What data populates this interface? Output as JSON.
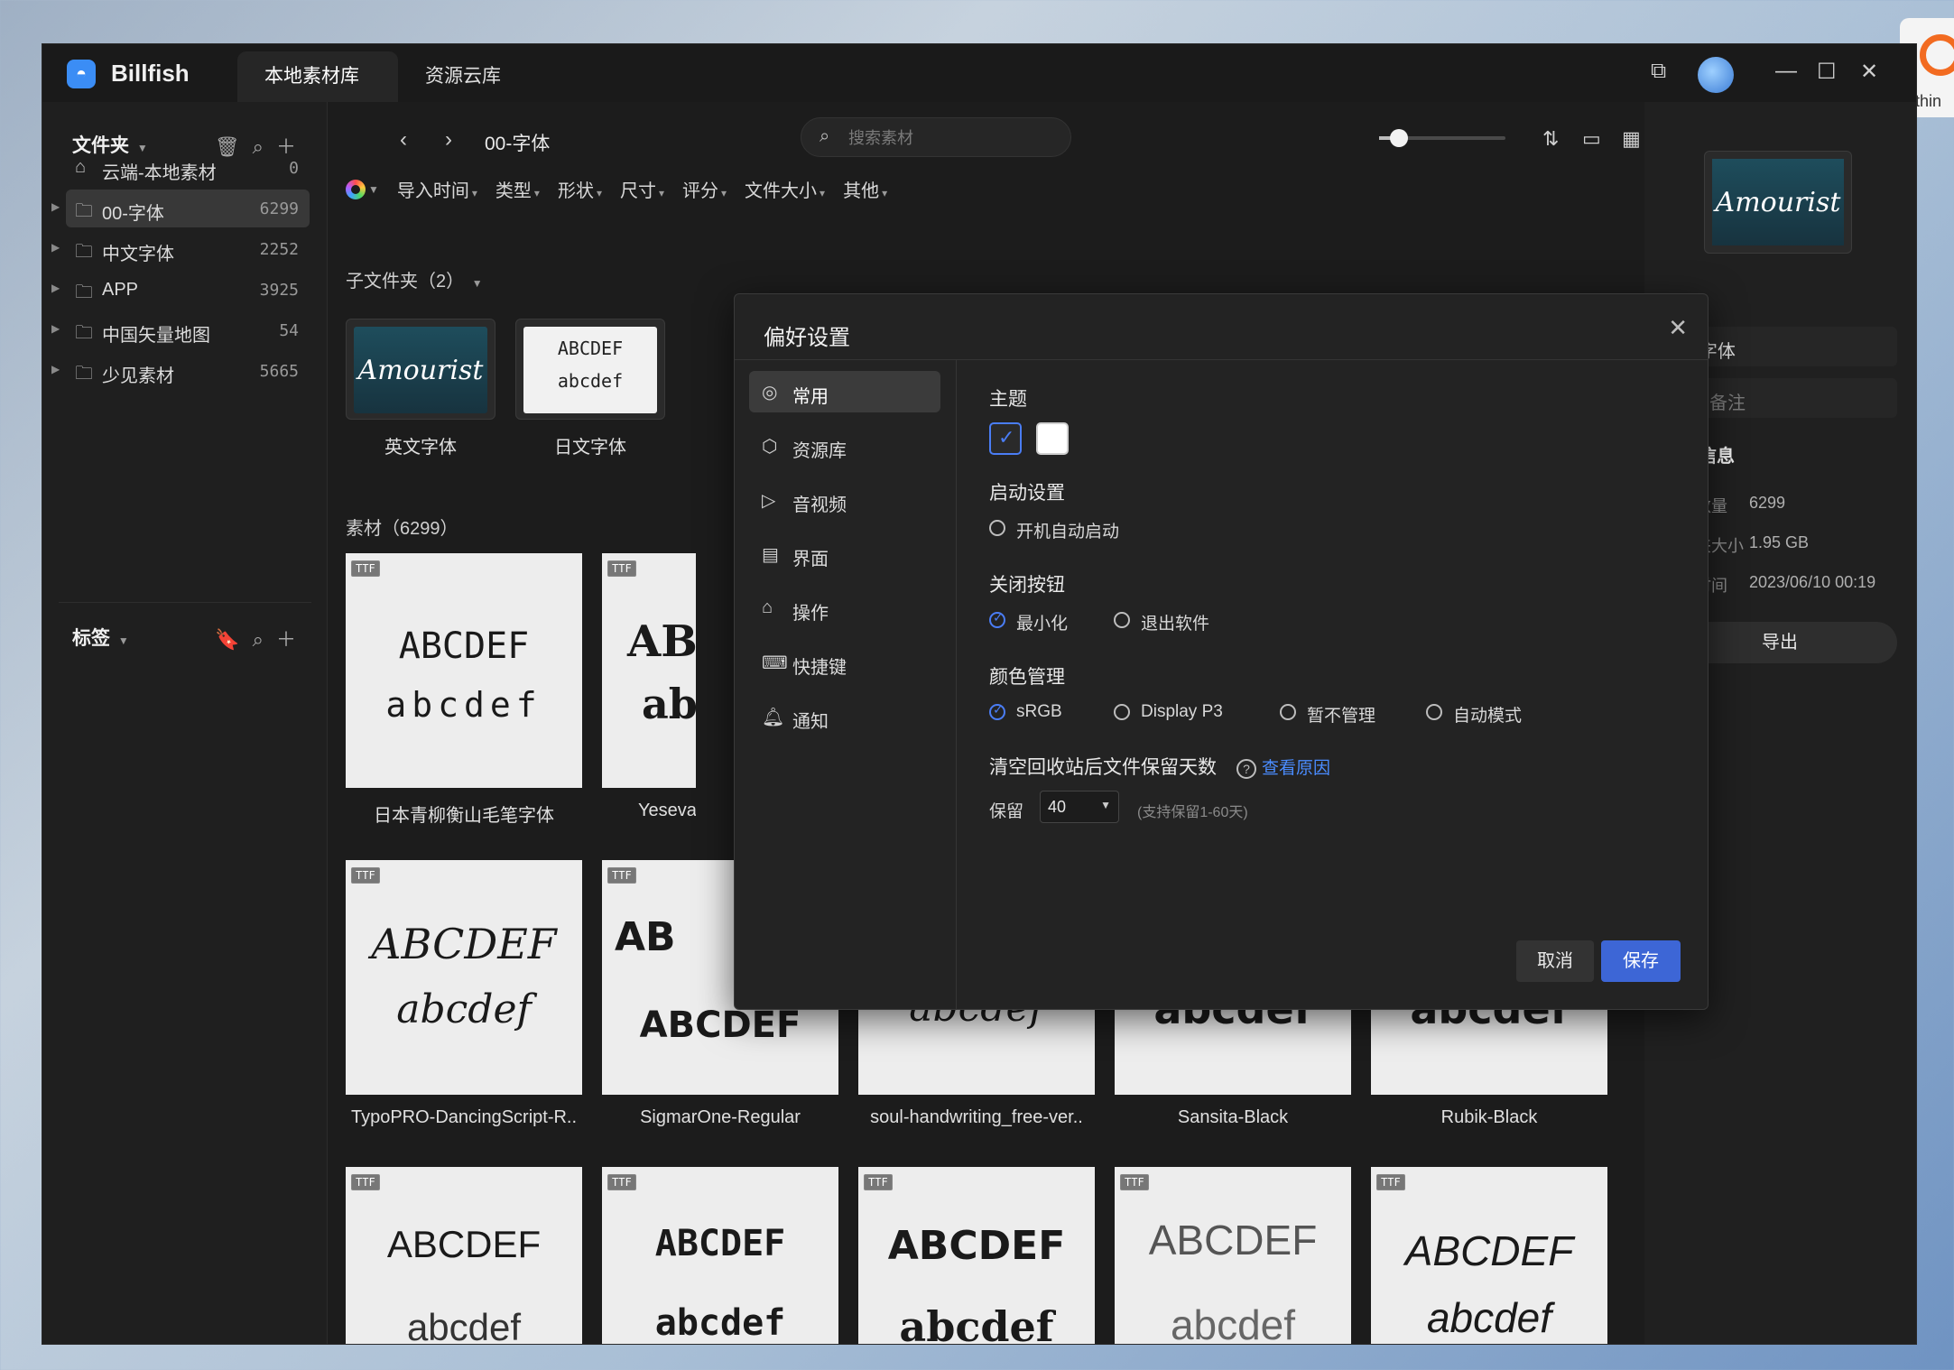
{
  "desktop": {
    "app_snippet": "ythin"
  },
  "titlebar": {
    "app_name": "Billfish",
    "tabs": [
      "本地素材库",
      "资源云库"
    ]
  },
  "sidebar": {
    "folders_header": "文件夹",
    "tags_header": "标签",
    "folders": [
      {
        "label": "云端-本地素材",
        "count": "0"
      },
      {
        "label": "00-字体",
        "count": "6299"
      },
      {
        "label": "中文字体",
        "count": "2252"
      },
      {
        "label": "APP",
        "count": "3925"
      },
      {
        "label": "中国矢量地图",
        "count": "54"
      },
      {
        "label": "少见素材",
        "count": "5665"
      }
    ]
  },
  "main": {
    "breadcrumb": "00-字体",
    "search_placeholder": "搜索素材",
    "filters": [
      "导入时间",
      "类型",
      "形状",
      "尺寸",
      "评分",
      "文件大小",
      "其他"
    ],
    "subfolders_label": "子文件夹（2）",
    "subfolders": [
      {
        "name": "英文字体",
        "preview": "Amourist"
      },
      {
        "name": "日文字体",
        "preview_line1": "ABCDEF",
        "preview_line2": "abcdef"
      }
    ],
    "assets_label": "素材（6299）",
    "badge": "TTF",
    "assets": [
      {
        "name": "日本青柳衡山毛笔字体",
        "g1": "ABCDEF",
        "g2": "abcdef"
      },
      {
        "name": "Yeseva",
        "g1": "AB",
        "g2": "ab"
      },
      {
        "name": "TypoPRO-DancingScript-R..",
        "g1": "ABCDEF",
        "g2": "abcdef"
      },
      {
        "name": "SigmarOne-Regular",
        "g1": "AB",
        "g2": "ABCDEF"
      },
      {
        "name": "soul-handwriting_free-ver..",
        "g1": "",
        "g2": "abcdef"
      },
      {
        "name": "Sansita-Black",
        "g1": "",
        "g2": "abcdef"
      },
      {
        "name": "Rubik-Black",
        "g1": "",
        "g2": "abcdef"
      },
      {
        "name": "",
        "g1": "ABCDEF",
        "g2": "abcdef"
      },
      {
        "name": "",
        "g1": "ABCDEF",
        "g2": "abcdef"
      },
      {
        "name": "",
        "g1": "ABCDEF",
        "g2": "abcdef"
      },
      {
        "name": "",
        "g1": "ABCDEF",
        "g2": "abcdef"
      },
      {
        "name": "",
        "g1": "ABCDEF",
        "g2": "abcdef"
      }
    ]
  },
  "right_panel": {
    "folder_name": "00-字体",
    "note_placeholder": "添加备注",
    "info_title": "素材信息",
    "rows": [
      {
        "label": "文件数量",
        "value": "6299"
      },
      {
        "label": "文件夹大小",
        "value": "1.95 GB"
      },
      {
        "label": "创建时间",
        "value": "2023/06/10 00:19"
      }
    ],
    "export_label": "导出"
  },
  "dialog": {
    "title": "偏好设置",
    "nav": [
      "常用",
      "资源库",
      "音视频",
      "界面",
      "操作",
      "快捷键",
      "通知"
    ],
    "theme_label": "主题",
    "startup_label": "启动设置",
    "startup_option": "开机自动启动",
    "close_label": "关闭按钮",
    "close_options": [
      "最小化",
      "退出软件"
    ],
    "color_label": "颜色管理",
    "color_options": [
      "sRGB",
      "Display P3",
      "暂不管理",
      "自动模式"
    ],
    "recycle_label": "清空回收站后文件保留天数",
    "recycle_help": "查看原因",
    "keep_label": "保留",
    "keep_value": "40",
    "keep_note": "(支持保留1-60天)",
    "cancel": "取消",
    "save": "保存"
  }
}
